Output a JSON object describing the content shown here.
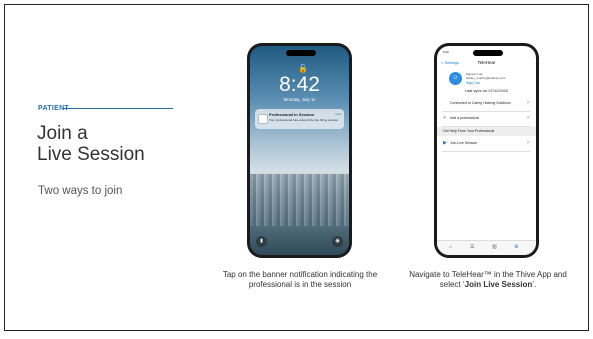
{
  "eyebrow": "PATIENT",
  "title_line1": "Join a",
  "title_line2": "Live Session",
  "subtitle": "Two ways to join",
  "phone1": {
    "time": "8:42",
    "date": "Monday, July 11",
    "notification": {
      "title": "Professional In Session",
      "time": "now",
      "body": "Your professional has entered the live fitting session."
    }
  },
  "phone2": {
    "status_time": "9:22",
    "nav_back": "< Settings",
    "nav_title": "TeleHear",
    "account_label": "Signed in as",
    "account_email": "ashley_murphy@starkey.com",
    "sign_out": "Sign Out",
    "last_sync": "Last sync on 07/11/2022",
    "rows": [
      "Connected to Caring Hearing Solutions",
      "Add a professional"
    ],
    "section": "Get Help From Your Professional",
    "join_row": "Join Live Session"
  },
  "caption1": "Tap on the banner notification indicating the professional is in the session",
  "caption2_pre": "Navigate to TeleHear™ in the Thive App and select ‘",
  "caption2_bold": "Join Live Session",
  "caption2_post": "’.",
  "colors": {
    "accent": "#1f6fa8",
    "link": "#1a7bd0"
  }
}
